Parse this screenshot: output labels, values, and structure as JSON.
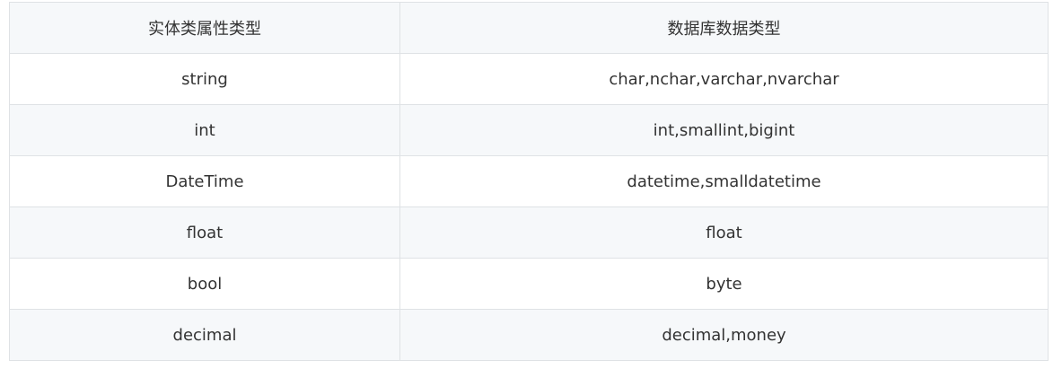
{
  "table": {
    "headers": [
      "实体类属性类型",
      "数据库数据类型"
    ],
    "rows": [
      [
        "string",
        "char,nchar,varchar,nvarchar"
      ],
      [
        "int",
        "int,smallint,bigint"
      ],
      [
        "DateTime",
        "datetime,smalldatetime"
      ],
      [
        "float",
        "float"
      ],
      [
        "bool",
        "byte"
      ],
      [
        "decimal",
        "decimal,money"
      ]
    ]
  },
  "colors": {
    "border": "#dfe2e5",
    "header_bg": "#f6f8fa",
    "stripe_bg": "#f6f8fa",
    "text": "#333333"
  }
}
